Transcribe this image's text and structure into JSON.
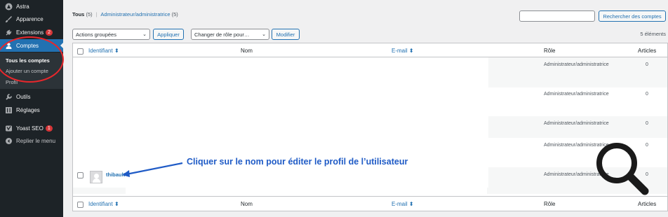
{
  "sidebar": {
    "items": [
      {
        "label": "Astra",
        "icon": "astra-icon"
      },
      {
        "label": "Apparence",
        "icon": "brush-icon"
      },
      {
        "label": "Extensions",
        "icon": "plug-icon",
        "badge": "2"
      },
      {
        "label": "Comptes",
        "icon": "users-icon",
        "active": true
      },
      {
        "label": "Outils",
        "icon": "wrench-icon"
      },
      {
        "label": "Réglages",
        "icon": "settings-icon"
      },
      {
        "label": "Yoast SEO",
        "icon": "yoast-icon",
        "badge": "1"
      },
      {
        "label": "Replier le menu",
        "icon": "collapse-icon"
      }
    ],
    "submenu": [
      "Tous les comptes",
      "Ajouter un compte",
      "Profil"
    ]
  },
  "filters": {
    "all_label": "Tous",
    "all_count": "(5)",
    "separator": "|",
    "admin_label": "Administrateur/administratrice",
    "admin_count": "(5)"
  },
  "search": {
    "button": "Rechercher des comptes",
    "value": ""
  },
  "bulk": {
    "select": "Actions groupées",
    "apply": "Appliquer"
  },
  "role_change": {
    "select": "Changer de rôle pour…",
    "apply": "Modifier"
  },
  "items_count": "5 éléments",
  "table": {
    "columns": [
      "Identifiant",
      "Nom",
      "E-mail",
      "Rôle",
      "Articles"
    ],
    "rows": [
      {
        "username": "",
        "role": "Administrateur/administratrice",
        "posts": "0"
      },
      {
        "username": "",
        "role": "Administrateur/administratrice",
        "posts": "0"
      },
      {
        "username": "",
        "role": "Administrateur/administratrice",
        "posts": "0"
      },
      {
        "username": "",
        "role": "Administrateur/administratrice",
        "posts": "0"
      },
      {
        "username": "thibault",
        "role": "Administrateur/administratrice",
        "posts": "0"
      }
    ]
  },
  "annotation": {
    "text": "Cliquer sur le nom pour éditer le profil de l’utilisateur"
  },
  "colors": {
    "accent": "#2271b1",
    "sidebar": "#1d2327",
    "annotation": "#1f5bc6",
    "highlight": "#e8272c"
  }
}
